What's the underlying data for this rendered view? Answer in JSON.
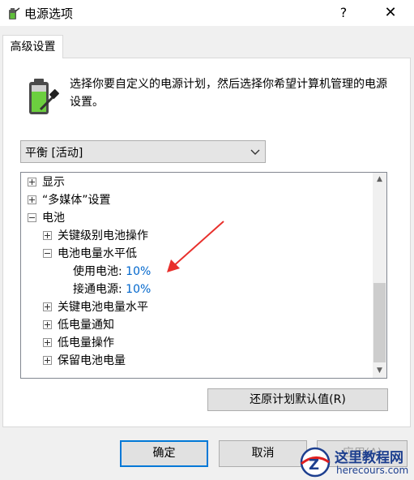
{
  "window": {
    "title": "电源选项",
    "help_label": "?",
    "close_label": "✕"
  },
  "tabs": [
    {
      "label": "高级设置"
    }
  ],
  "intro": {
    "icon": "battery-plug-icon",
    "text": "选择你要自定义的电源计划，然后选择你希望计算机管理的电源设置。"
  },
  "plan_select": {
    "value": "平衡 [活动]"
  },
  "tree": {
    "items": [
      {
        "label": "显示",
        "expander": "plus"
      },
      {
        "label": "“多媒体”设置",
        "expander": "plus"
      },
      {
        "label": "电池",
        "expander": "minus"
      },
      {
        "label": "关键级别电池操作",
        "expander": "plus"
      },
      {
        "label": "电池电量水平低",
        "expander": "minus"
      },
      {
        "label": "使用电池:",
        "value": "10%"
      },
      {
        "label": "接通电源:",
        "value": "10%"
      },
      {
        "label": "关键电池电量水平",
        "expander": "plus"
      },
      {
        "label": "低电量通知",
        "expander": "plus"
      },
      {
        "label": "低电量操作",
        "expander": "plus"
      },
      {
        "label": "保留电池电量",
        "expander": "plus"
      }
    ]
  },
  "buttons": {
    "restore_defaults": "还原计划默认值(R)",
    "ok": "确定",
    "cancel": "取消",
    "apply": "应用(A)"
  },
  "watermark": {
    "title": "这里教程网",
    "url": "herecours.com"
  },
  "colors": {
    "accent": "#0078d7",
    "link_value": "#0066cc",
    "annotation_arrow": "#e8302c",
    "watermark": "#1d3f8f"
  }
}
